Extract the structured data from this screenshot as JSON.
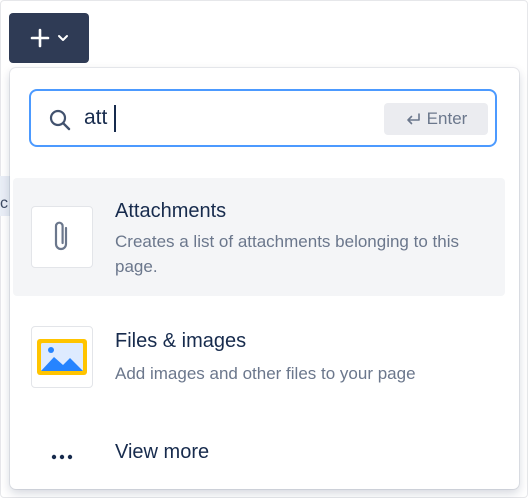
{
  "toolbar": {
    "insert_button_icon": "plus-icon",
    "insert_menu_icon": "chevron-down-icon",
    "button_color": "#2f3b55"
  },
  "background": {
    "partial_text": "c"
  },
  "search": {
    "icon": "search-icon",
    "value": "att",
    "enter_hint_icon": "return-arrow-icon",
    "enter_hint_label": "Enter",
    "focus_color": "#4c9aff"
  },
  "results": [
    {
      "icon": "paperclip-icon",
      "title": "Attachments",
      "description": "Creates a list of attachments belonging to this page.",
      "selected": true
    },
    {
      "icon": "image-icon",
      "title": "Files & images",
      "description": "Add images and other files to your page",
      "selected": false
    }
  ],
  "view_more": {
    "icon": "more-dots-icon",
    "label": "View more"
  }
}
